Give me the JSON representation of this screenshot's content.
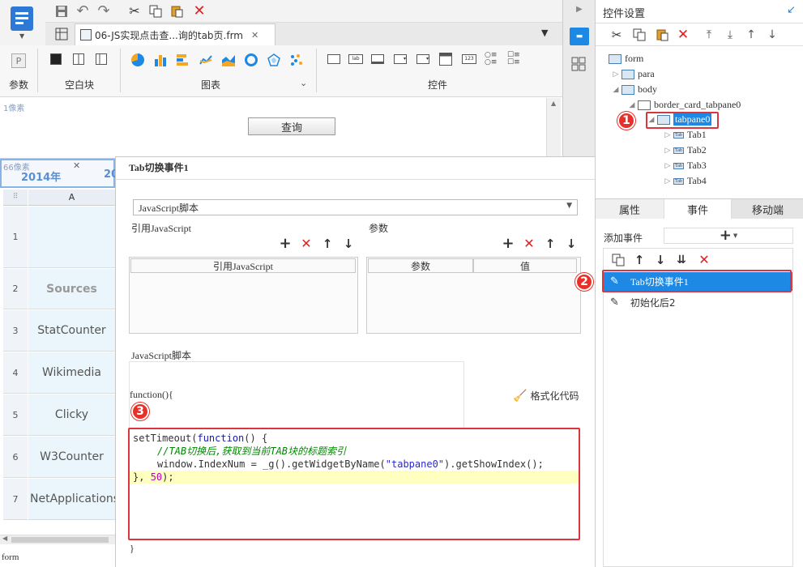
{
  "document_tab": {
    "title": "06-JS实现点击查...询的tab页.frm"
  },
  "ribbon": {
    "group_param": "参数",
    "group_blank": "空白块",
    "group_chart": "图表",
    "group_widget": "控件"
  },
  "canvas": {
    "pixel_label_top": "1像素",
    "query_button": "查询",
    "pixel_label_grid": "66像素",
    "tab_year_1": "2014年",
    "tab_year_2": "20",
    "column_a": "A",
    "status_form": "form",
    "rows": [
      {
        "num": "1",
        "value": ""
      },
      {
        "num": "2",
        "value": "Sources"
      },
      {
        "num": "3",
        "value": "StatCounter"
      },
      {
        "num": "4",
        "value": "Wikimedia"
      },
      {
        "num": "5",
        "value": "Clicky"
      },
      {
        "num": "6",
        "value": "W3Counter"
      },
      {
        "num": "7",
        "value": "NetApplications"
      }
    ]
  },
  "dialog": {
    "title": "Tab切换事件1",
    "type_select": "JavaScript脚本",
    "ref_js_label": "引用JavaScript",
    "params_label": "参数",
    "ref_js_col": "引用JavaScript",
    "param_col": "参数",
    "value_col": "值",
    "script_label": "JavaScript脚本",
    "function_open": "function(){",
    "format_code": "格式化代码",
    "function_close": "}",
    "code": {
      "l1_a": "setTimeout(",
      "l1_kw": "function",
      "l1_b": "() {",
      "l2_comment": "//TAB切换后,获取到当前TAB块的标题索引",
      "l3_a": "window.IndexNum = _g().getWidgetByName(",
      "l3_str": "\"tabpane0\"",
      "l3_b": ").getShowIndex();",
      "l4_a": "}, ",
      "l4_num": "50",
      "l4_b": ");"
    }
  },
  "right_panel": {
    "title": "控件设置",
    "tree": {
      "form": "form",
      "para": "para",
      "body": "body",
      "border_card": "border_card_tabpane0",
      "tabpane": "tabpane0",
      "tab1": "Tab1",
      "tab2": "Tab2",
      "tab3": "Tab3",
      "tab4": "Tab4",
      "mini_tab": "Tab"
    },
    "tabs": {
      "attr": "属性",
      "event": "事件",
      "mobile": "移动端"
    },
    "add_event_label": "添加事件",
    "add_symbol": "+",
    "events": [
      "Tab切换事件1",
      "初始化后2"
    ]
  },
  "badges": [
    "1",
    "2",
    "3"
  ],
  "colors": {
    "accent_blue": "#1e88e5",
    "highlight_red": "#d9363e",
    "code_keyword": "#1a1aa6",
    "code_comment": "#008800",
    "code_string": "#2a2acc",
    "code_number": "#c000c0",
    "highlight_line": "#ffffc0"
  }
}
